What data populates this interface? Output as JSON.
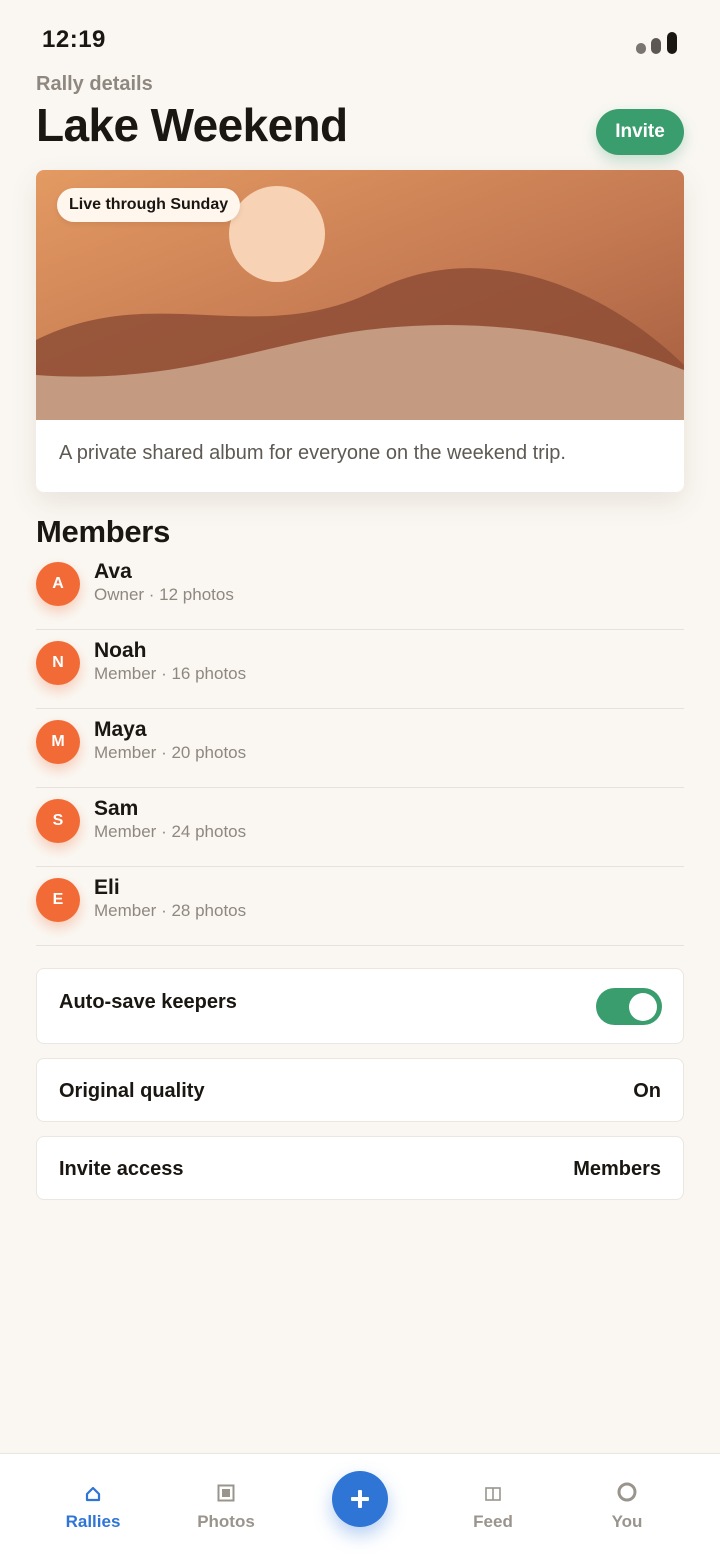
{
  "status_bar": {
    "time": "12:19"
  },
  "header": {
    "eyebrow": "Rally details",
    "title": "Lake Weekend",
    "invite_label": "Invite"
  },
  "hero": {
    "badge": "Live through Sunday",
    "description": "A private shared album for everyone on the weekend trip."
  },
  "members": {
    "title": "Members",
    "items": [
      {
        "initial": "A",
        "name": "Ava",
        "meta": "Owner · 12 photos"
      },
      {
        "initial": "N",
        "name": "Noah",
        "meta": "Member · 16 photos"
      },
      {
        "initial": "M",
        "name": "Maya",
        "meta": "Member · 20 photos"
      },
      {
        "initial": "S",
        "name": "Sam",
        "meta": "Member · 24 photos"
      },
      {
        "initial": "E",
        "name": "Eli",
        "meta": "Member · 28 photos"
      }
    ]
  },
  "settings": {
    "auto_save": {
      "label": "Auto-save keepers",
      "enabled": true
    },
    "original_quality": {
      "label": "Original quality",
      "value": "On"
    },
    "invite_access": {
      "label": "Invite access",
      "value": "Members"
    }
  },
  "tab_bar": {
    "tabs": [
      {
        "label": "Rallies",
        "icon": "home-icon",
        "active": true
      },
      {
        "label": "Photos",
        "icon": "photo-icon",
        "active": false
      },
      {
        "label": "Feed",
        "icon": "feed-icon",
        "active": false
      },
      {
        "label": "You",
        "icon": "profile-icon",
        "active": false
      }
    ],
    "fab_icon": "plus-icon"
  },
  "colors": {
    "accent_green": "#3a9d6e",
    "accent_blue": "#2f75d6",
    "avatar_orange": "#f26a35",
    "background": "#faf7f2"
  }
}
